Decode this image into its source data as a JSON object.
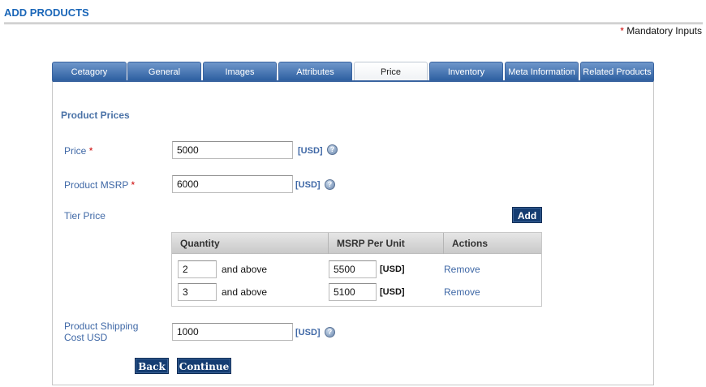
{
  "page": {
    "title": "ADD PRODUCTS",
    "mandatory_star": "*",
    "mandatory_text": "Mandatory Inputs"
  },
  "tabs": [
    {
      "label": "Cetagory"
    },
    {
      "label": "General"
    },
    {
      "label": "Images"
    },
    {
      "label": "Attributes"
    },
    {
      "label": "Price",
      "active": true
    },
    {
      "label": "Inventory"
    },
    {
      "label": "Meta Information"
    },
    {
      "label": "Related Products"
    }
  ],
  "section": {
    "title": "Product Prices"
  },
  "price": {
    "label": "Price",
    "required_mark": "*",
    "value": "5000",
    "currency": "[USD]"
  },
  "msrp": {
    "label": "Product MSRP",
    "required_mark": "*",
    "value": "6000",
    "currency": "[USD]"
  },
  "tier": {
    "label": "Tier Price",
    "add_label": "Add",
    "columns": [
      "Quantity",
      "MSRP Per Unit",
      "Actions"
    ],
    "rows": [
      {
        "quantity": "2",
        "suffix": "and above",
        "msrp": "5500",
        "currency": "[USD]",
        "action": "Remove"
      },
      {
        "quantity": "3",
        "suffix": "and above",
        "msrp": "5100",
        "currency": "[USD]",
        "action": "Remove"
      }
    ]
  },
  "shipping": {
    "label_line1": "Product Shipping",
    "label_line2": "Cost USD",
    "value": "1000",
    "currency": "[USD]"
  },
  "help_icon": "question-mark",
  "buttons": {
    "back": "Back",
    "continue": "Continue"
  },
  "colors": {
    "accent": "#1a66b8",
    "tab_blue": "#2a5d9f",
    "label_blue": "#3f68a6",
    "button_navy": "#153d72",
    "required_red": "#cc0000"
  }
}
